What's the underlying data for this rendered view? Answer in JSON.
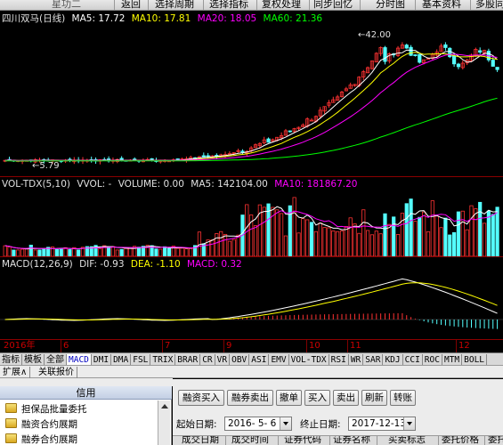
{
  "menu": {
    "items": [
      "星功二",
      "返回",
      "选择周期",
      "选择指标",
      "复权处理",
      "同步回忆",
      "分时图",
      "基本资料",
      "多股同列"
    ]
  },
  "kline": {
    "stock_name": "四川双马(日线)",
    "ma5": "MA5: 17.72",
    "ma10": "MA10: 17.81",
    "ma20": "MA20: 18.05",
    "ma60": "MA60: 21.36",
    "high_label": "42.00",
    "low_label": "5.79",
    "colors": {
      "ma5": "#ffffff",
      "ma10": "#ffff00",
      "ma20": "#ff00ff",
      "ma60": "#00ff00",
      "up": "#ff3232",
      "down": "#54ffff"
    }
  },
  "volume": {
    "header": "VOL-TDX(5,10)",
    "vvol": "VVOL: -",
    "volume": "VOLUME: 0.00",
    "ma5": "MA5: 142104.00",
    "ma10": "MA10: 181867.20"
  },
  "macd": {
    "header": "MACD(12,26,9)",
    "dif": "DIF: -0.93",
    "dea": "DEA: -1.10",
    "macd": "MACD: 0.32"
  },
  "timeaxis": {
    "labels": [
      "2016年",
      "6",
      "7",
      "9",
      "10",
      "11",
      "12"
    ]
  },
  "indicator_tabs": [
    "指标",
    "模板",
    "全部",
    "MACD",
    "DMI",
    "DMA",
    "FSL",
    "TRIX",
    "BRAR",
    "CR",
    "VR",
    "OBV",
    "ASI",
    "EMV",
    "VOL-TDX",
    "RSI",
    "WR",
    "SAR",
    "KDJ",
    "CCI",
    "ROC",
    "MTM",
    "BOLL"
  ],
  "active_tab": "MACD",
  "ext_tabs": [
    "扩展∧",
    "关联报价"
  ],
  "credit_panel": {
    "title": "信用",
    "items": [
      "担保品批量委托",
      "融资合约展期",
      "融券合约展期"
    ]
  },
  "trade_panel": {
    "buttons": [
      "融资买入",
      "融券卖出",
      "撤单",
      "买入",
      "卖出",
      "刷新",
      "转账"
    ],
    "start_label": "起始日期:",
    "start_value": "2016- 5- 6",
    "end_label": "终止日期:",
    "end_value": "2017-12-13",
    "columns": [
      "成交日期",
      "成交时间",
      "证券代码",
      "证券名称",
      "买卖标志",
      "委托价格",
      "委托数量"
    ]
  }
}
